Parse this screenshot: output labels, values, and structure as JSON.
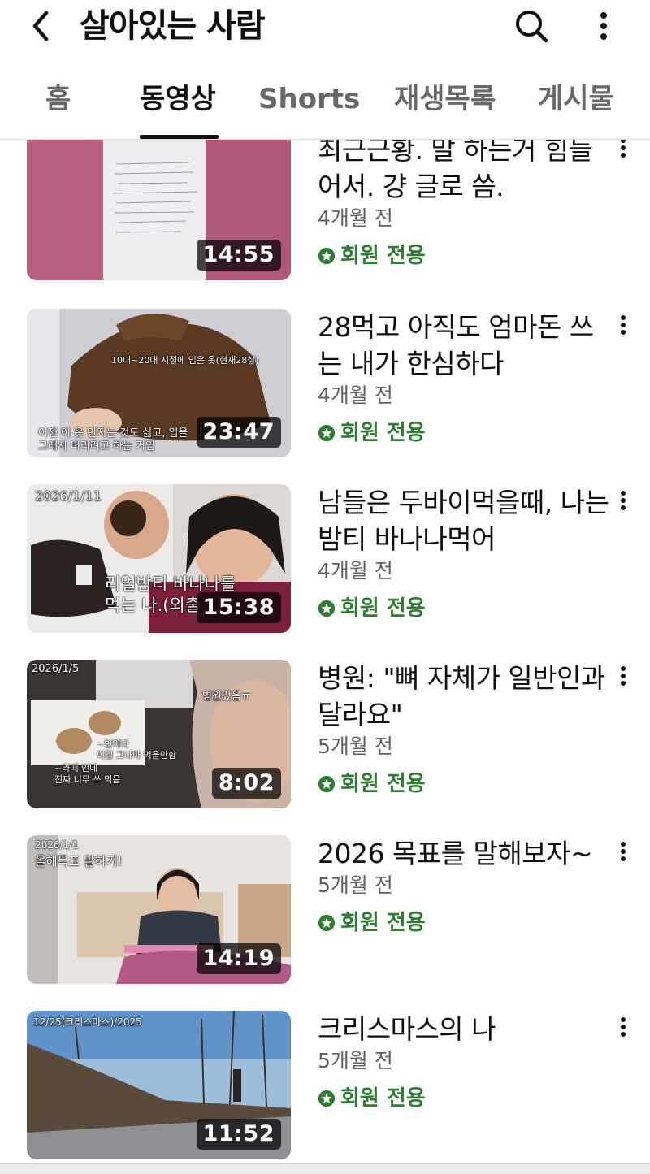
{
  "header": {
    "title": "살아있는 사람",
    "back_icon": "chevron-left-icon",
    "search_icon": "search-icon",
    "more_icon": "more-vertical-icon"
  },
  "tabs": [
    {
      "label": "홈",
      "active": false
    },
    {
      "label": "동영상",
      "active": true
    },
    {
      "label": "Shorts",
      "active": false
    },
    {
      "label": "재생목록",
      "active": false
    },
    {
      "label": "게시물",
      "active": false
    }
  ],
  "colors": {
    "members_green": "#2e7d32",
    "meta_gray": "#606060",
    "tab_inactive": "#686868"
  },
  "videos": [
    {
      "title": "최근근황. 말 하는거 힘들어서. 걍 글로 씀.",
      "age": "4개월 전",
      "badge": "회원 전용",
      "duration": "14:55",
      "overlays": []
    },
    {
      "title": "28먹고 아직도 엄마돈 쓰는 내가 한심하다",
      "age": "4개월 전",
      "badge": "회원 전용",
      "duration": "23:47",
      "overlays": [
        "10대~20대 시절에 입은 옷(현재28살)",
        "이젠 이 옷 만지는 것도 싫고, 입을",
        "그래서 버리려고 하는 거임"
      ]
    },
    {
      "title": "남들은 두바이먹을때, 나는 밤티 바나나먹어",
      "age": "4개월 전",
      "badge": "회원 전용",
      "duration": "15:38",
      "overlays": [
        "2026/1/11",
        "리얼밤티 바나나를",
        "먹는 나.(외출"
      ]
    },
    {
      "title": "병원: \"뼈 자체가 일반인과 달라요\"",
      "age": "5개월 전",
      "badge": "회원 전용",
      "duration": "8:02",
      "overlays": [
        "2026/1/5",
        "병원갔음ㅠ",
        "~빈이다",
        "이걸 그나마 먹을만함",
        "~라떼 인데",
        "진짜 너무 쓰 먹음"
      ]
    },
    {
      "title": "2026 목표를 말해보자~",
      "age": "5개월 전",
      "badge": "회원 전용",
      "duration": "14:19",
      "overlays": [
        "2026/1/1",
        "올해목표 말하기!"
      ]
    },
    {
      "title": "크리스마스의 나",
      "age": "5개월 전",
      "badge": "회원 전용",
      "duration": "11:52",
      "overlays": [
        "12/25(크리스마스)/2025"
      ]
    }
  ]
}
